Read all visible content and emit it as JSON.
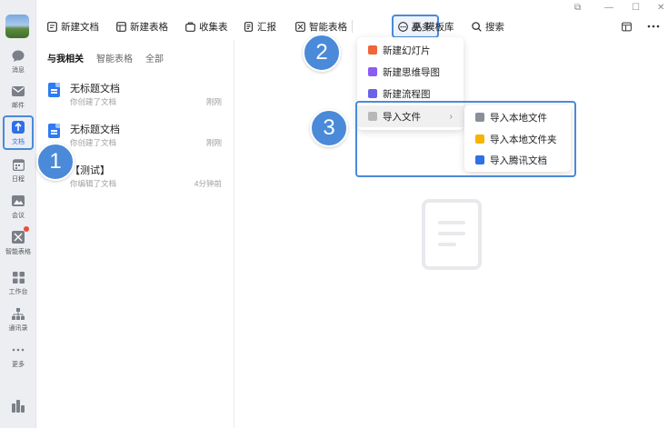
{
  "rail": {
    "items": [
      {
        "label": "消息",
        "icon": "chat-bubble-icon"
      },
      {
        "label": "邮件",
        "icon": "mail-icon"
      },
      {
        "label": "文档",
        "icon": "document-upload-icon"
      },
      {
        "label": "日程",
        "icon": "calendar-icon"
      },
      {
        "label": "会议",
        "icon": "meeting-icon"
      },
      {
        "label": "智能表格",
        "icon": "smart-sheet-icon"
      },
      {
        "label": "工作台",
        "icon": "grid-apps-icon"
      },
      {
        "label": "通讯录",
        "icon": "org-chart-icon"
      },
      {
        "label": "更多",
        "icon": "more-dots-icon"
      }
    ]
  },
  "toolbar": {
    "new_doc": "新建文档",
    "new_sheet": "新建表格",
    "form": "收集表",
    "report": "汇报",
    "smart_sheet": "智能表格",
    "more": "更多",
    "templates": "模板库",
    "search": "搜索"
  },
  "panel": {
    "tabs": [
      "与我相关",
      "智能表格",
      "全部"
    ],
    "docs": [
      {
        "name": "无标题文档",
        "sub": "你创建了文档",
        "time": "刚刚"
      },
      {
        "name": "无标题文档",
        "sub": "你创建了文档",
        "time": "刚刚"
      },
      {
        "name": "【测试】",
        "sub": "你编辑了文档",
        "time": "4分钟前"
      }
    ]
  },
  "more_menu": {
    "items": [
      "新建幻灯片",
      "新建思维导图",
      "新建流程图",
      "导入文件"
    ]
  },
  "import_menu": {
    "items": [
      "导入本地文件",
      "导入本地文件夹",
      "导入腾讯文档"
    ]
  },
  "callouts": [
    "1",
    "2",
    "3"
  ],
  "colors": {
    "accent": "#4a8ad8",
    "doc_blue": "#2f7bf0",
    "slide_orange": "#f0653a",
    "mind_purple": "#8a5cf0",
    "flow_purple": "#6a62e8",
    "folder_yellow": "#f5b400"
  }
}
